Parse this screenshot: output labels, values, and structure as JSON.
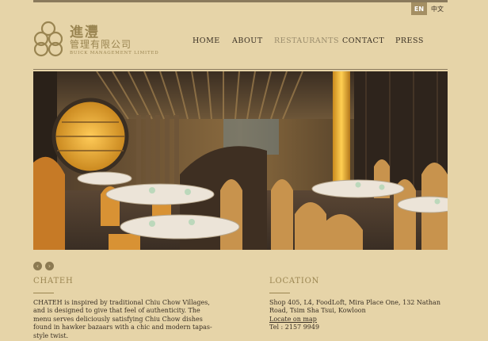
{
  "language": {
    "en": "EN",
    "zh": "中文"
  },
  "logo": {
    "cn_line1": "進灃",
    "cn_line2": "管理有限公司",
    "en_line": "BUICK MANAGEMENT LIMITED"
  },
  "nav": {
    "items": [
      {
        "label": "HOME"
      },
      {
        "label": "ABOUT"
      },
      {
        "label": "RESTAURANTS",
        "active": true
      },
      {
        "label": "CONTACT"
      },
      {
        "label": "PRESS"
      }
    ]
  },
  "carousel": {
    "prev_icon": "‹",
    "next_icon": "›"
  },
  "restaurant": {
    "title": "CHATEH",
    "description_lines": [
      "CHATEH is inspired by traditional Chiu Chow Villages,",
      "and is designed to give that feel of authenticity. The",
      "menu serves deliciously satisfying Chiu Chow dishes",
      "found in hawker bazaars with a chic and modern tapas-",
      "style twist."
    ]
  },
  "location": {
    "title": "LOCATION",
    "address_lines": [
      "Shop 405, L4, FoodLoft, Mira Place One, 132 Nathan",
      "Road, Tsim Sha Tsui, Kowloon"
    ],
    "map_link": "Locate on map",
    "tel": "Tel : 2157 9949"
  },
  "colors": {
    "background": "#e6d4a8",
    "accent": "#9a8551",
    "text": "#3a3024"
  }
}
